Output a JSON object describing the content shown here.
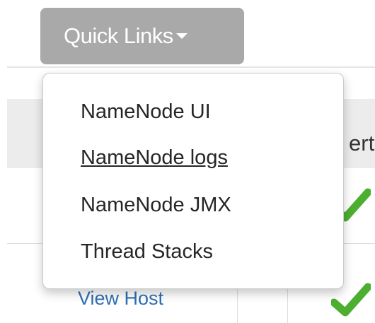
{
  "quick_links": {
    "label": "Quick Links",
    "icon": "caret-down-icon",
    "menu": [
      {
        "label": "NameNode UI",
        "hovered": false
      },
      {
        "label": "NameNode logs",
        "hovered": true
      },
      {
        "label": "NameNode JMX",
        "hovered": false
      },
      {
        "label": "Thread Stacks",
        "hovered": false
      }
    ]
  },
  "table": {
    "header_partial": "ert",
    "view_host_label": "View Host",
    "status_icon": "checkmark-icon",
    "status_color": "#4caf2f"
  },
  "colors": {
    "button_bg": "#a9a9a9",
    "link": "#2f6fb4"
  }
}
